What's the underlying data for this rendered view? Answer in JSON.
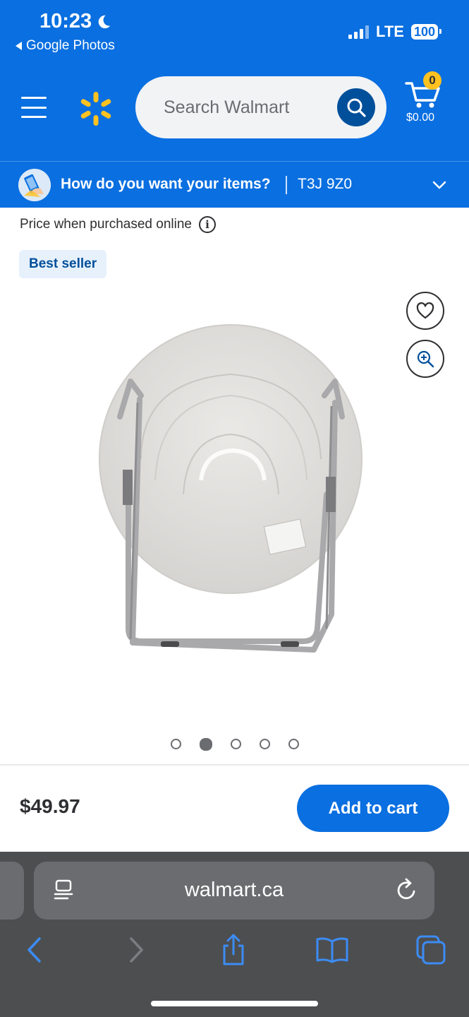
{
  "status_bar": {
    "time": "10:23",
    "back_app": "Google Photos",
    "network": "LTE",
    "battery": "100"
  },
  "header": {
    "search_placeholder": "Search Walmart",
    "cart_count": "0",
    "cart_total": "$0.00"
  },
  "delivery": {
    "question": "How do you want your items?",
    "postal_code": "T3J 9Z0"
  },
  "product": {
    "price_note": "Price when purchased online",
    "badge": "Best seller",
    "price": "$49.97",
    "add_to_cart": "Add to cart",
    "carousel": {
      "total": 5,
      "active_index": 1
    }
  },
  "browser": {
    "url": "walmart.ca"
  },
  "colors": {
    "walmart_blue": "#0a6fe0",
    "walmart_dark_blue": "#004f9a",
    "spark_yellow": "#ffc220",
    "safari_bar": "#4d4e50",
    "safari_accent": "#3c8cf5"
  },
  "icons": [
    "moon-icon",
    "signal-icon",
    "battery-icon",
    "menu-icon",
    "walmart-spark-logo",
    "search-icon",
    "cart-icon",
    "delivery-icon",
    "chevron-down-icon",
    "info-icon",
    "heart-icon",
    "zoom-in-icon",
    "reader-icon",
    "reload-icon",
    "back-icon",
    "forward-icon",
    "share-icon",
    "bookmarks-icon",
    "tabs-icon"
  ]
}
